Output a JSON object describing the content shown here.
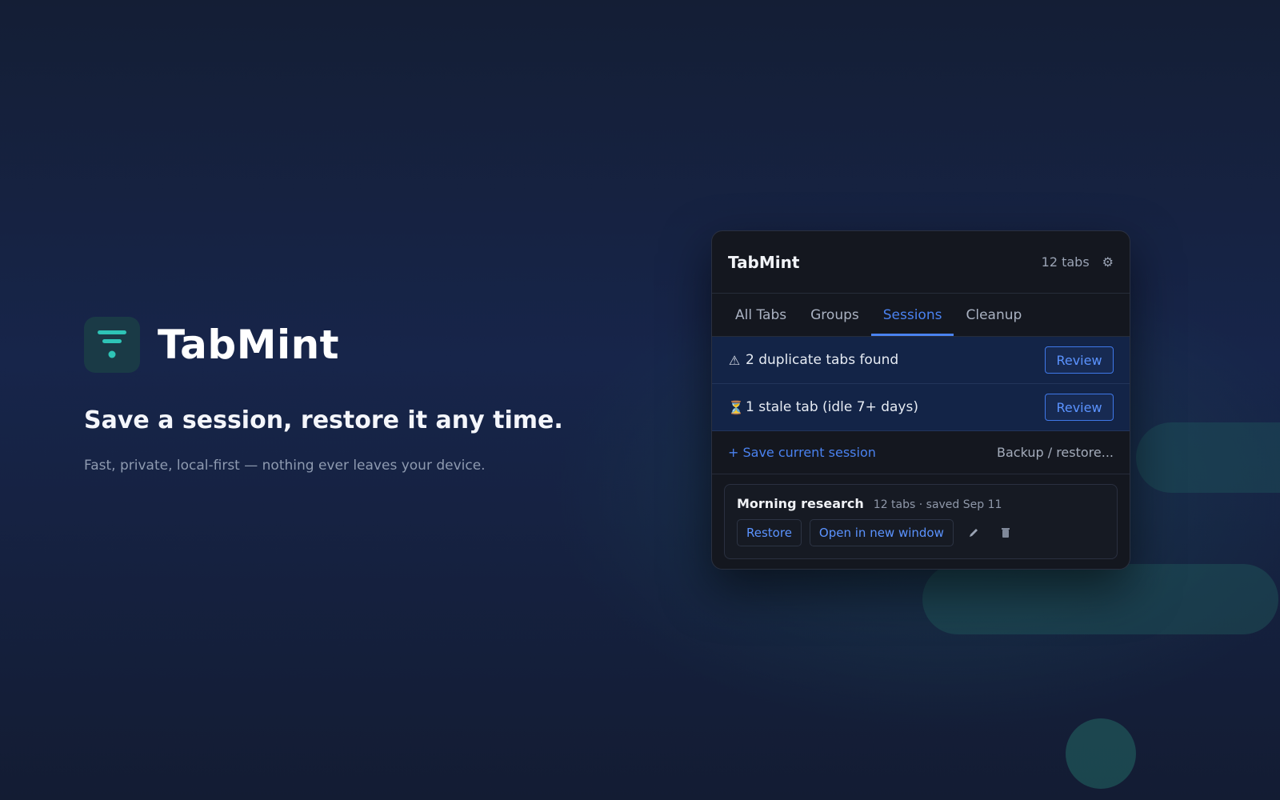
{
  "hero": {
    "brand_name": "TabMint",
    "headline": "Save a session, restore it any time.",
    "subline": "Fast, private, local-first — nothing ever leaves your device."
  },
  "popup": {
    "title": "TabMint",
    "tab_count": "12 tabs",
    "settings_icon": "gear-icon",
    "tabs": [
      {
        "label": "All Tabs",
        "active": false
      },
      {
        "label": "Groups",
        "active": false
      },
      {
        "label": "Sessions",
        "active": true
      },
      {
        "label": "Cleanup",
        "active": false
      }
    ],
    "alerts": [
      {
        "icon": "⚠",
        "icon_name": "warning-icon",
        "text": "2 duplicate tabs found",
        "action": "Review"
      },
      {
        "icon": "⏳",
        "icon_name": "hourglass-icon",
        "text": "1 stale tab (idle 7+ days)",
        "action": "Review"
      }
    ],
    "save_session_label": "+ Save current session",
    "backup_label": "Backup / restore...",
    "session": {
      "name": "Morning research",
      "meta": "12 tabs · saved Sep 11",
      "restore_label": "Restore",
      "open_new_window_label": "Open in new window",
      "edit_icon": "pencil-icon",
      "delete_icon": "trash-icon"
    }
  },
  "colors": {
    "accent": "#4a82f0",
    "logo_teal": "#2ec4b6",
    "alert_bg": "#132447",
    "panel_bg": "#14171f"
  }
}
